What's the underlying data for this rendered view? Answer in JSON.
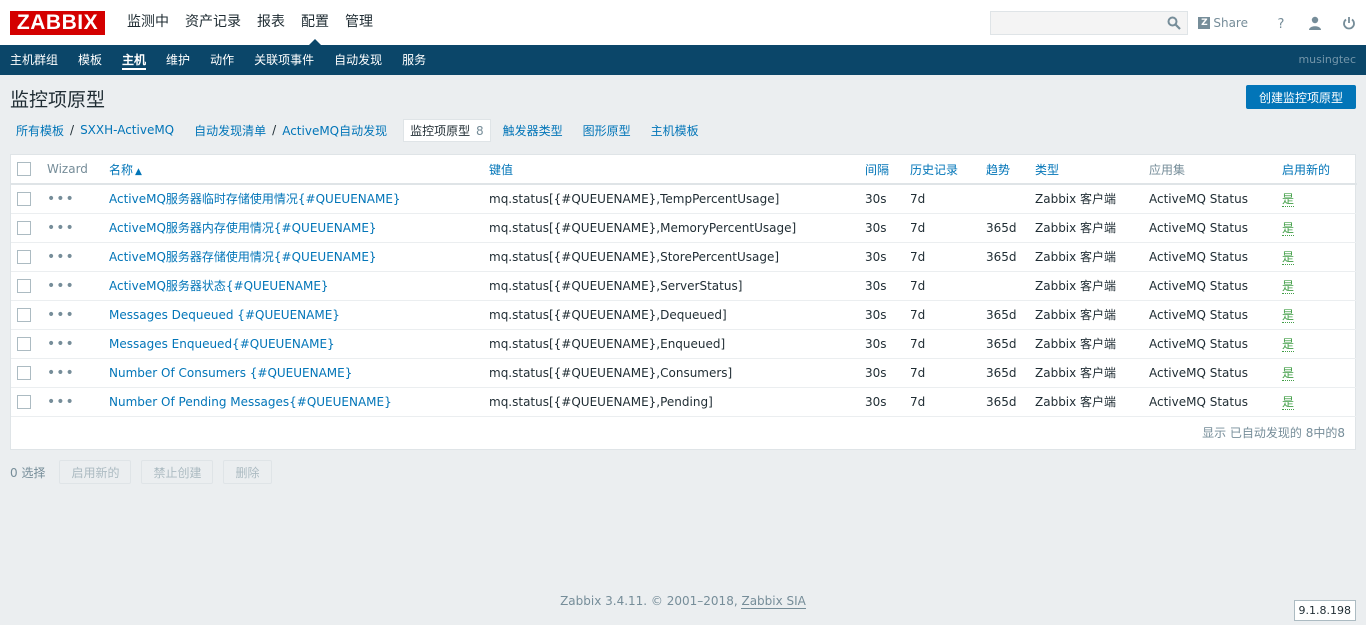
{
  "header": {
    "logo": "ZABBIX",
    "menu": [
      {
        "label": "监测中"
      },
      {
        "label": "资产记录"
      },
      {
        "label": "报表"
      },
      {
        "label": "配置"
      },
      {
        "label": "管理"
      }
    ],
    "share_label": "Share",
    "share_badge": "Z"
  },
  "subnav": {
    "items": [
      {
        "label": "主机群组"
      },
      {
        "label": "模板"
      },
      {
        "label": "主机"
      },
      {
        "label": "维护"
      },
      {
        "label": "动作"
      },
      {
        "label": "关联项事件"
      },
      {
        "label": "自动发现"
      },
      {
        "label": "服务"
      }
    ],
    "user": "musingtec"
  },
  "page": {
    "title": "监控项原型",
    "create_button": "创建监控项原型"
  },
  "breadcrumbs": {
    "all_templates": "所有模板",
    "sep": "/",
    "template": "SXXH-ActiveMQ",
    "discovery_list": "自动发现清单",
    "discovery": "ActiveMQ自动发现",
    "current": "监控项原型",
    "current_count": "8",
    "triggers": "触发器类型",
    "graphs": "图形原型",
    "host_templates": "主机模板"
  },
  "table": {
    "headers": {
      "wizard": "Wizard",
      "name": "名称",
      "key": "键值",
      "interval": "间隔",
      "history": "历史记录",
      "trends": "趋势",
      "type": "类型",
      "application": "应用集",
      "create_enabled": "启用新的"
    },
    "rows": [
      {
        "name": "ActiveMQ服务器临时存储使用情况{#QUEUENAME}",
        "key": "mq.status[{#QUEUENAME},TempPercentUsage]",
        "interval": "30s",
        "history": "7d",
        "trends": "",
        "type": "Zabbix 客户端",
        "application": "ActiveMQ Status",
        "status": "是"
      },
      {
        "name": "ActiveMQ服务器内存使用情况{#QUEUENAME}",
        "key": "mq.status[{#QUEUENAME},MemoryPercentUsage]",
        "interval": "30s",
        "history": "7d",
        "trends": "365d",
        "type": "Zabbix 客户端",
        "application": "ActiveMQ Status",
        "status": "是"
      },
      {
        "name": "ActiveMQ服务器存储使用情况{#QUEUENAME}",
        "key": "mq.status[{#QUEUENAME},StorePercentUsage]",
        "interval": "30s",
        "history": "7d",
        "trends": "365d",
        "type": "Zabbix 客户端",
        "application": "ActiveMQ Status",
        "status": "是"
      },
      {
        "name": "ActiveMQ服务器状态{#QUEUENAME}",
        "key": "mq.status[{#QUEUENAME},ServerStatus]",
        "interval": "30s",
        "history": "7d",
        "trends": "",
        "type": "Zabbix 客户端",
        "application": "ActiveMQ Status",
        "status": "是"
      },
      {
        "name": "Messages Dequeued {#QUEUENAME}",
        "key": "mq.status[{#QUEUENAME},Dequeued]",
        "interval": "30s",
        "history": "7d",
        "trends": "365d",
        "type": "Zabbix 客户端",
        "application": "ActiveMQ Status",
        "status": "是"
      },
      {
        "name": "Messages Enqueued{#QUEUENAME}",
        "key": "mq.status[{#QUEUENAME},Enqueued]",
        "interval": "30s",
        "history": "7d",
        "trends": "365d",
        "type": "Zabbix 客户端",
        "application": "ActiveMQ Status",
        "status": "是"
      },
      {
        "name": "Number Of Consumers {#QUEUENAME}",
        "key": "mq.status[{#QUEUENAME},Consumers]",
        "interval": "30s",
        "history": "7d",
        "trends": "365d",
        "type": "Zabbix 客户端",
        "application": "ActiveMQ Status",
        "status": "是"
      },
      {
        "name": "Number Of Pending Messages{#QUEUENAME}",
        "key": "mq.status[{#QUEUENAME},Pending]",
        "interval": "30s",
        "history": "7d",
        "trends": "365d",
        "type": "Zabbix 客户端",
        "application": "ActiveMQ Status",
        "status": "是"
      }
    ],
    "footer": "显示 已自动发现的 8中的8"
  },
  "actions": {
    "selected": "0 选择",
    "enable": "启用新的",
    "disable": "禁止创建",
    "delete": "删除"
  },
  "footer": {
    "text": "Zabbix 3.4.11. © 2001–2018, ",
    "link": "Zabbix SIA",
    "version": "9.1.8.198"
  },
  "icons": {
    "search": "search-icon",
    "help": "help-icon",
    "user": "user-icon",
    "logout": "power-icon",
    "row_menu": "ellipsis-icon"
  },
  "colors": {
    "brand_red": "#d40000",
    "nav_blue": "#0b4669",
    "link_blue": "#0275b8",
    "status_green": "#429e47"
  }
}
